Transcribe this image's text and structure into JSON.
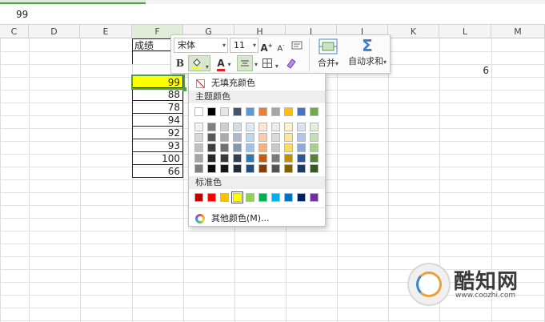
{
  "formula_bar": {
    "value": "99"
  },
  "columns": [
    "C",
    "D",
    "E",
    "F",
    "G",
    "H",
    "I",
    "J",
    "K",
    "L",
    "M"
  ],
  "selected_column": "F",
  "sheet": {
    "header_cell": "成绩",
    "scores": [
      "99",
      "88",
      "78",
      "94",
      "92",
      "93",
      "100",
      "66"
    ],
    "side_value": "6"
  },
  "mini_toolbar": {
    "font_name": "宋体",
    "font_size": "11",
    "grow_font": "A",
    "shrink_font": "A",
    "bold": "B",
    "font_color": "A",
    "merge_label": "合并",
    "autosum_label": "自动求和",
    "dropdown_arrow": "▾"
  },
  "color_menu": {
    "no_fill_label": "无填充颜色",
    "theme_section_label": "主题颜色",
    "standard_section_label": "标准色",
    "more_colors_label": "其他颜色(M)...",
    "theme_base": [
      "#ffffff",
      "#000000",
      "#e7e6e6",
      "#44546a",
      "#5b9bd5",
      "#ed7d31",
      "#a5a5a5",
      "#ffc000",
      "#4472c4",
      "#70ad47"
    ],
    "theme_shades": [
      [
        "#f2f2f2",
        "#7f7f7f",
        "#d0cece",
        "#d6dce4",
        "#deebf6",
        "#fbe5d5",
        "#ededed",
        "#fff2cc",
        "#d9e2f3",
        "#e2efd9"
      ],
      [
        "#d8d8d8",
        "#595959",
        "#aeaaaa",
        "#adb9ca",
        "#bdd7ee",
        "#f7cbac",
        "#dbdbdb",
        "#fee599",
        "#b4c6e7",
        "#c5e0b3"
      ],
      [
        "#bfbfbf",
        "#3f3f3f",
        "#757070",
        "#8496b0",
        "#9cc3e5",
        "#f4b183",
        "#c9c9c9",
        "#ffd965",
        "#8eaadb",
        "#a8d08d"
      ],
      [
        "#a5a5a5",
        "#262626",
        "#3a3838",
        "#323f4f",
        "#2e75b5",
        "#c55a11",
        "#7b7b7b",
        "#bf9000",
        "#2f5496",
        "#538135"
      ],
      [
        "#7f7f7f",
        "#0c0c0c",
        "#171616",
        "#222a35",
        "#1e4e79",
        "#833c0b",
        "#525252",
        "#7f6000",
        "#1f3864",
        "#375623"
      ]
    ],
    "standard_colors": [
      "#c00000",
      "#ff0000",
      "#ffc000",
      "#ffff00",
      "#92d050",
      "#00b050",
      "#00b0f0",
      "#0070c0",
      "#002060",
      "#7030a0"
    ],
    "selected_standard_index": 3
  },
  "highlight_color": "#ffff00",
  "accent_color": "#4ca33f",
  "watermark": {
    "brand": "酷知网",
    "url": "www.coozhi.com"
  }
}
